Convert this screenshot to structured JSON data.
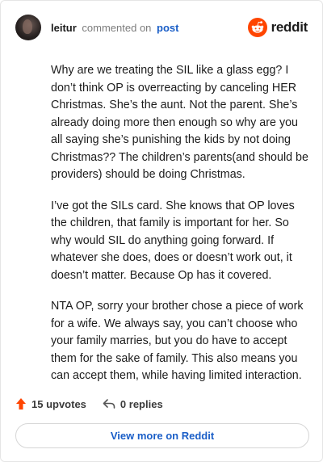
{
  "header": {
    "username": "leitur",
    "action_text": "commented on",
    "post_link": "post",
    "brand": "reddit"
  },
  "comment": {
    "paragraphs": [
      "Why are we treating the SIL like a glass egg? I don’t think OP is overreacting by canceling HER Christmas. She’s the aunt. Not the parent. She’s already doing more then enough so why are you all saying she’s punishing the kids by not doing Christmas?? The children’s parents(and should be providers) should be doing Christmas.",
      "I’ve got the SILs card. She knows that OP loves the children, that family is important for her. So why would SIL do anything going forward. If whatever she does, does or doesn’t work out, it doesn’t matter. Because Op has it covered.",
      "NTA OP, sorry your brother chose a piece of work for a wife. We always say, you can’t choose who your family marries, but you do have to accept them for the sake of family. This also means you can accept them, while having limited interaction."
    ]
  },
  "actions": {
    "upvotes": "15 upvotes",
    "replies": "0 replies"
  },
  "footer": {
    "view_more": "View more on Reddit"
  },
  "icons": {
    "upvote": "upvote-arrow-icon",
    "reply": "reply-arrow-icon",
    "brand": "reddit-snoo-icon"
  },
  "colors": {
    "brand_orange": "#ff4500",
    "link_blue": "#1a5ec7",
    "border": "#e5e5e5"
  }
}
